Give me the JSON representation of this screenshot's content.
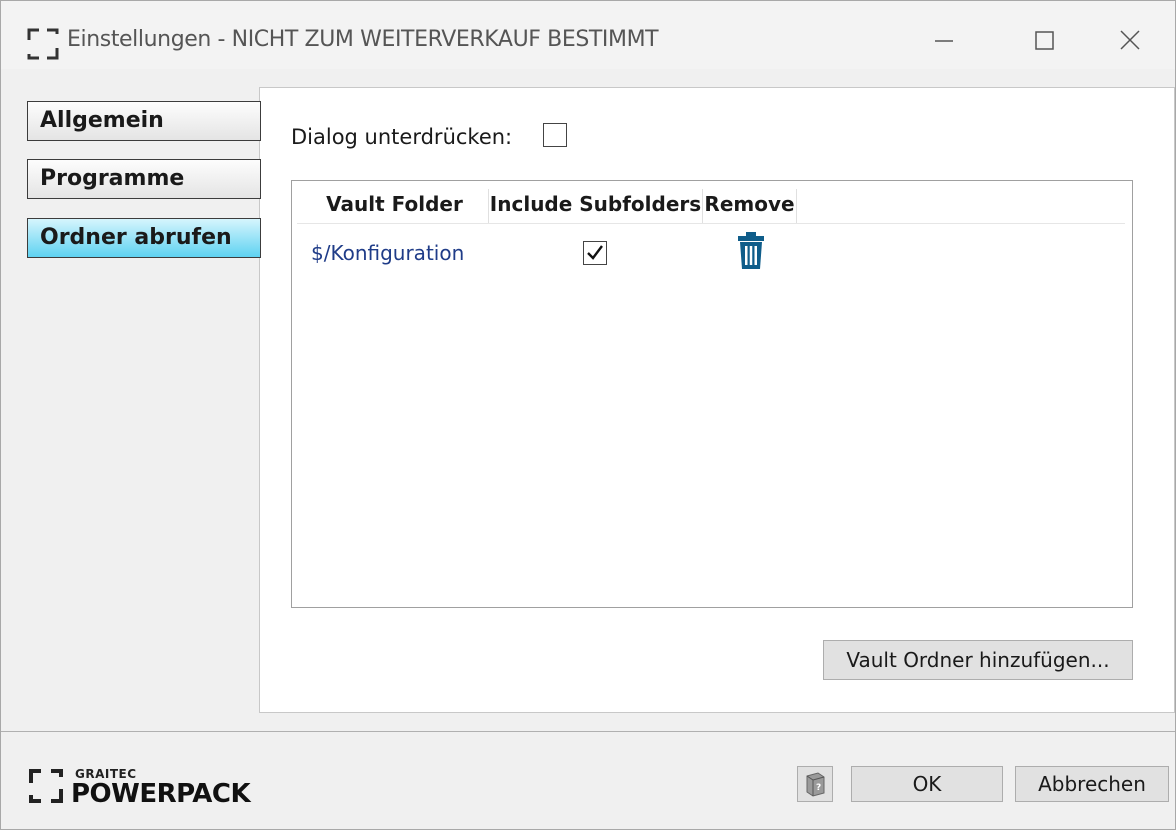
{
  "window": {
    "title": "Einstellungen - NICHT ZUM WEITERVERKAUF BESTIMMT",
    "icon": "graitec-bracket-icon",
    "controls": [
      "minimize-icon",
      "maximize-icon",
      "close-icon"
    ]
  },
  "nav": {
    "items": [
      {
        "label": "Allgemein",
        "selected": false
      },
      {
        "label": "Programme",
        "selected": false
      },
      {
        "label": "Ordner abrufen",
        "selected": true
      }
    ],
    "selected_color": "#5ed2f1"
  },
  "main": {
    "suppress_label": "Dialog unterdrücken:",
    "suppress_checked": false,
    "table": {
      "columns": [
        "Vault Folder",
        "Include Subfolders",
        "Remove"
      ],
      "rows": [
        {
          "folder": "$/Konfiguration",
          "include_subfolders": true,
          "remove_icon": "trash-icon"
        }
      ]
    },
    "add_button": "Vault Ordner hinzufügen..."
  },
  "footer": {
    "logo_small": "GRAITEC",
    "logo_big": "POWERPACK",
    "help_icon": "help-book-icon",
    "ok": "OK",
    "cancel": "Abbrechen"
  },
  "colors": {
    "link": "#1f3c88",
    "trash": "#0f5d8a"
  }
}
